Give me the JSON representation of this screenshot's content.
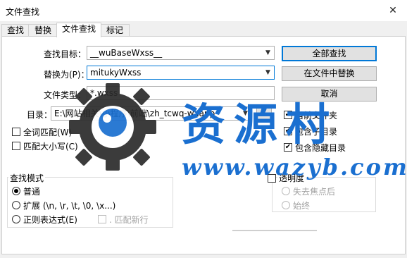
{
  "window": {
    "title": "文件查找",
    "close_glyph": "✕"
  },
  "tabs": [
    {
      "label": "查找"
    },
    {
      "label": "替换"
    },
    {
      "label": "文件查找"
    },
    {
      "label": "标记"
    }
  ],
  "fields": {
    "find_label": "查找目标：",
    "find_value": "__wuBaseWxss__",
    "replace_label": "替换为(P)：",
    "replace_value": "mitukyWxss",
    "filetype_label": "文件类型：",
    "filetype_value": "*.wxss",
    "dir_label": "目录：",
    "dir_value": "E:\\网站相关\\小程序\\前端\\zh_tcwq-wxapp",
    "dir_browse": "..."
  },
  "buttons": {
    "find_all": "全部查找",
    "replace_in_files": "在文件中替换",
    "cancel": "取消"
  },
  "options": {
    "whole_word": "全词匹配(W)",
    "match_case": "匹配大小写(C)",
    "follow_current": "当前文件夹",
    "subfolders": "包含子目录",
    "hidden_folders": "包含隐藏目录",
    "follow_current_checked": true,
    "subfolders_checked": true,
    "hidden_checked": true,
    "whole_word_checked": false,
    "match_case_checked": false
  },
  "search_mode": {
    "title": "查找模式",
    "normal": "普通",
    "extended": "扩展 (\\n, \\r, \\t, \\0, \\x...)",
    "regex": "正则表达式(E)",
    "dot_newline": ". 匹配新行",
    "selected": "normal"
  },
  "transparency": {
    "title": "透明度",
    "on_lose_focus": "失去焦点后",
    "always": "始终",
    "checked": false
  },
  "watermark": {
    "text_cn": "资源村",
    "text_url": "www.wazyb.com",
    "color": "#1a6fd0"
  }
}
